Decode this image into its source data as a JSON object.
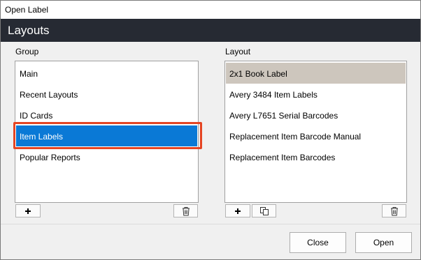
{
  "window": {
    "title": "Open Label"
  },
  "header": {
    "title": "Layouts"
  },
  "group": {
    "label": "Group",
    "items": [
      {
        "label": "Main"
      },
      {
        "label": "Recent Layouts"
      },
      {
        "label": "ID Cards"
      },
      {
        "label": "Item Labels"
      },
      {
        "label": "Popular Reports"
      }
    ],
    "selected": "Item Labels",
    "toolbar": {
      "add_icon": "plus-icon",
      "delete_icon": "trash-icon"
    }
  },
  "layout": {
    "label": "Layout",
    "items": [
      {
        "label": "2x1 Book Label"
      },
      {
        "label": "Avery 3484 Item Labels"
      },
      {
        "label": "Avery L7651 Serial Barcodes"
      },
      {
        "label": "Replacement Item Barcode Manual"
      },
      {
        "label": "Replacement Item Barcodes"
      }
    ],
    "selected": "2x1 Book Label",
    "toolbar": {
      "add_icon": "plus-icon",
      "copy_icon": "copy-icon",
      "delete_icon": "trash-icon"
    }
  },
  "footer": {
    "close_label": "Close",
    "open_label": "Open"
  },
  "colors": {
    "header_bg": "#262a33",
    "selection_blue": "#0a79d6",
    "selection_gray": "#cdc6bd",
    "highlight_red": "#e54523"
  }
}
